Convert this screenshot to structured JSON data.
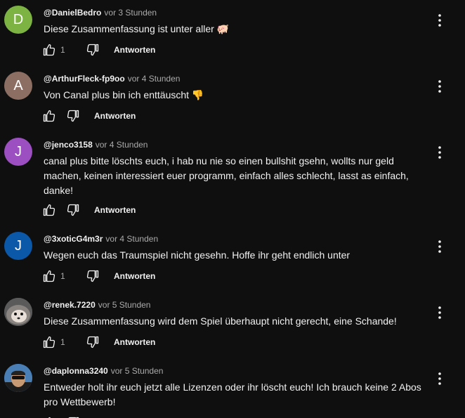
{
  "comments": [
    {
      "author": "@DanielBedro",
      "time": "vor 3 Stunden",
      "text": "Diese Zusammenfassung ist unter aller 🐖",
      "likes": "1",
      "reply_label": "Antworten",
      "avatar_letter": "D",
      "avatar_color": "#7cb342"
    },
    {
      "author": "@ArthurFleck-fp9oo",
      "time": "vor 4 Stunden",
      "text": "Von Canal plus bin ich enttäuscht 👎",
      "likes": "",
      "reply_label": "Antworten",
      "avatar_letter": "A",
      "avatar_color": "#8d6e63"
    },
    {
      "author": "@jenco3158",
      "time": "vor 4 Stunden",
      "text": "canal plus bitte löschts euch, i hab nu nie so einen bullshit gsehn, wollts nur geld machen, keinen interessiert euer programm, einfach alles schlecht, lasst as einfach, danke!",
      "likes": "",
      "reply_label": "Antworten",
      "avatar_letter": "J",
      "avatar_color": "#9c4fc0"
    },
    {
      "author": "@3xoticG4m3r",
      "time": "vor 4 Stunden",
      "text": "Wegen euch das Traumspiel nicht gesehn. Hoffe ihr geht endlich unter",
      "likes": "1",
      "reply_label": "Antworten",
      "avatar_letter": "J",
      "avatar_color": "#0b57a8"
    },
    {
      "author": "@renek.7220",
      "time": "vor 5 Stunden",
      "text": "Diese Zusammenfassung wird dem Spiel überhaupt nicht gerecht, eine Schande!",
      "likes": "1",
      "reply_label": "Antworten",
      "avatar_letter": "",
      "avatar_color": "#6b6b6b"
    },
    {
      "author": "@daplonna3240",
      "time": "vor 5 Stunden",
      "text": "Entweder holt ihr euch jetzt alle Lizenzen oder ihr löscht euch! Ich brauch keine 2 Abos pro Wettbewerb!",
      "likes": "",
      "reply_label": "Antworten",
      "avatar_letter": "",
      "avatar_color": "#3a6ea5"
    }
  ]
}
